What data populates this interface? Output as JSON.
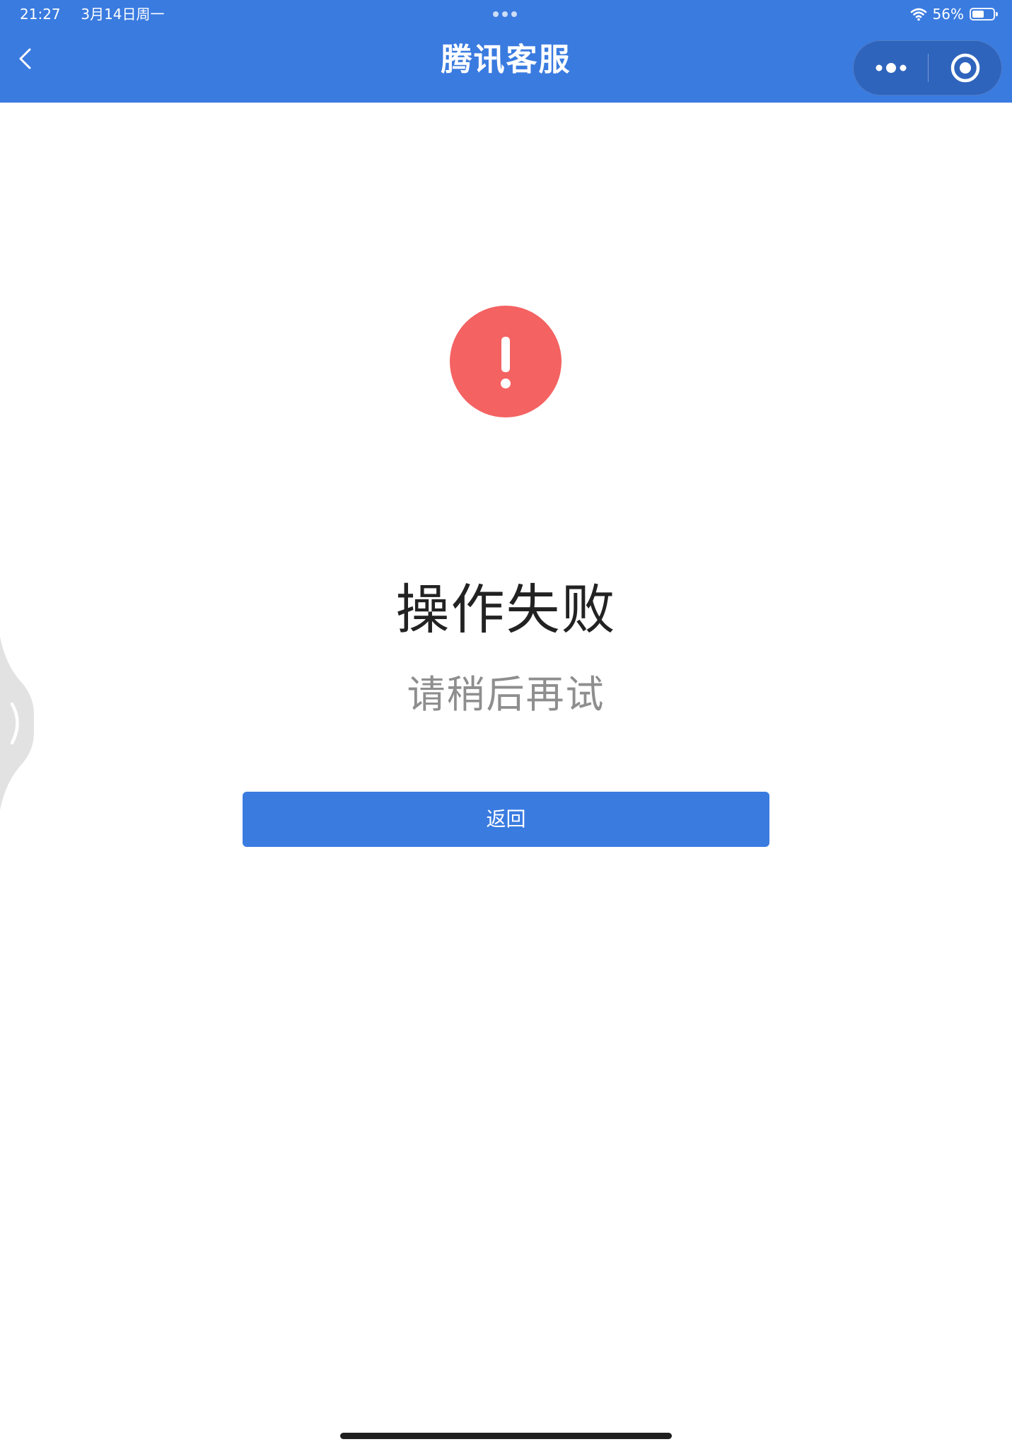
{
  "status_bar": {
    "time": "21:27",
    "date": "3月14日周一",
    "battery_text": "56%",
    "battery_level": 0.56
  },
  "nav": {
    "title": "腾讯客服"
  },
  "error": {
    "title": "操作失败",
    "subtitle": "请稍后再试",
    "button_label": "返回"
  },
  "colors": {
    "brand_blue": "#3a7be0",
    "capsule_blue": "#2f64bd",
    "error_red": "#f46262",
    "title_text": "#222222",
    "sub_text": "#8e8e8e"
  },
  "icons": {
    "back": "chevron-left-icon",
    "more": "more-dots-icon",
    "close": "target-circle-icon",
    "error": "exclamation-circle-icon",
    "side": "chevron-right-icon",
    "wifi": "wifi-icon",
    "battery": "battery-icon"
  }
}
